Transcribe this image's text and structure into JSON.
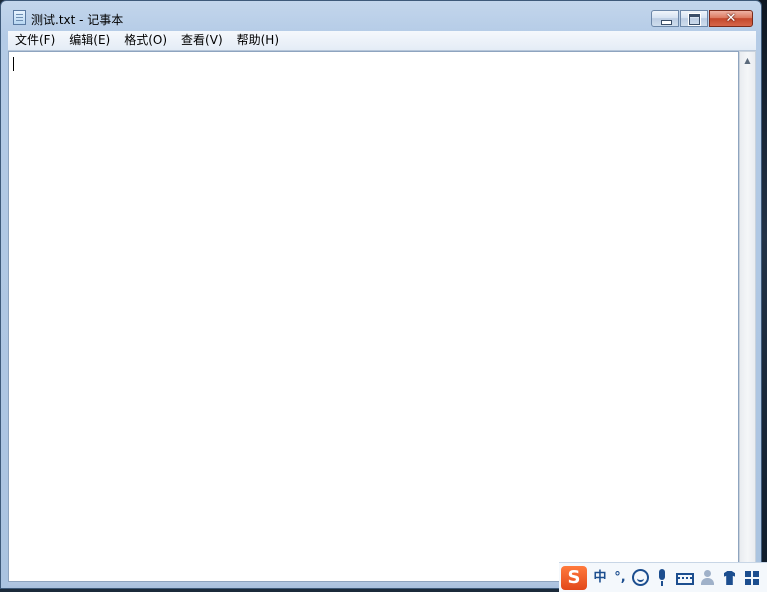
{
  "window": {
    "title": "测试.txt - 记事本",
    "buttons": {
      "minimize": "minimize-icon",
      "maximize": "restore-icon",
      "close": "✕"
    }
  },
  "menu": {
    "items": [
      {
        "label": "文件(F)"
      },
      {
        "label": "编辑(E)"
      },
      {
        "label": "格式(O)"
      },
      {
        "label": "查看(V)"
      },
      {
        "label": "帮助(H)"
      }
    ]
  },
  "editor": {
    "content": ""
  },
  "scrollbar": {
    "up_arrow": "▲"
  },
  "ime": {
    "logo": "S",
    "mode": "中",
    "punct": "°,",
    "icons": [
      "smile-icon",
      "microphone-icon",
      "keyboard-icon",
      "user-icon",
      "skin-icon",
      "toolbox-icon"
    ]
  },
  "colors": {
    "titlebar": "#b4cbe6",
    "close_button": "#c3472b",
    "ime_accent": "#1c4e8f",
    "ime_logo": "#e2481a"
  }
}
